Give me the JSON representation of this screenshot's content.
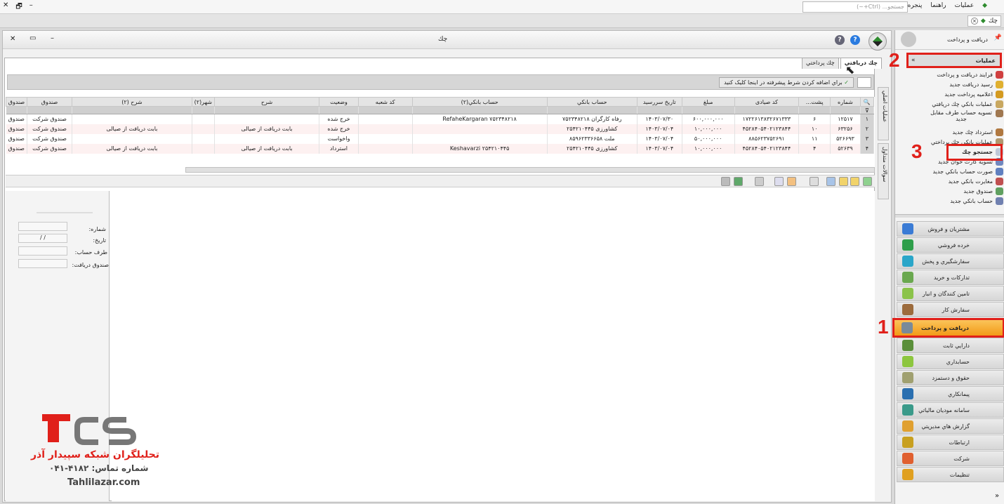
{
  "app": {
    "menu": [
      "عملیات",
      "راهنما",
      "پنجره"
    ],
    "search_placeholder": "جستجو... (Ctrl+~)",
    "doc_tab": "چك"
  },
  "window": {
    "title": "چك"
  },
  "tabs": [
    "چك دريافتي",
    "چك پرداختي"
  ],
  "filter_hint": "براي اضافه كردن شرط پيشرفته در اينجا كليک كنيد",
  "grid": {
    "columns": [
      "شماره",
      "پشت...",
      "کد صیادی",
      "مبلغ",
      "تاريخ سررسيد",
      "حساب بانكي",
      "حساب بانكي(۲)",
      "کد شعبه",
      "وضعیت",
      "شرح",
      "شهر(۲)",
      "شرح (۲)",
      "صندوق",
      "صندوق"
    ],
    "rows": [
      {
        "n": "۱",
        "cells": [
          "۱۲۵۱۷",
          "۶",
          "۱۷۲۲۶۱۳۸۳۲۶۷۱۳۳۳",
          "۶۰۰,۰۰۰,۰۰۰",
          "۱۴۰۳/۰۷/۳۰",
          "رفاه کارگران  ۷۵۲۳۴۸۲۱۸",
          "RefaheKargaran  ۷۵۲۳۴۸۲۱۸",
          "",
          "خرج شده",
          "",
          "",
          "",
          "صندوق شرکت",
          "صندوق"
        ]
      },
      {
        "n": "۲",
        "cells": [
          "۶۳۲۵۶",
          "۱۰",
          "۴۵۲۸۴۰۵۴۰۲۱۲۳۸۴۴",
          "۱۰,۰۰۰,۰۰۰",
          "۱۴۰۳/۰۷/۰۴",
          "کشاورزی  ۲۵۴۲۱۰۴۴۵",
          "",
          "",
          "خرج شده",
          "بابت دریافت از صیالی",
          "",
          "بابت دریافت از صیالی",
          "صندوق شرکت",
          "صندوق"
        ]
      },
      {
        "n": "۳",
        "cells": [
          "۵۲۶۶۹۳",
          "۱۱",
          "۸۸۵۶۲۳۷۵۲۶۹۱",
          "۵۰,۰۰۰,۰۰۰",
          "۱۴۰۳/۰۷/۰۴",
          "ملت  ۸۵۹۶۲۳۳۶۶۵۸",
          "",
          "",
          "واخواست",
          "",
          "",
          "",
          "صندوق شرکت",
          "صندوق"
        ]
      },
      {
        "n": "۴",
        "cells": [
          "۵۲۶۳۹",
          "۴",
          "۴۵۲۸۴۰۵۴۰۲۱۲۳۸۴۴",
          "۱۰,۰۰۰,۰۰۰",
          "۱۴۰۳/۰۷/۰۴",
          "کشاورزی  ۲۵۴۲۱۰۴۴۵",
          "Keshavarzi  ۲۵۴۲۱۰۴۴۵",
          "",
          "استرداد",
          "بابت دریافت از صیالی",
          "",
          "بابت دریافت از صیالی",
          "صندوق شرکت",
          "صندوق"
        ]
      }
    ]
  },
  "details": {
    "number": "شماره:",
    "date": "تاريخ:",
    "date_value": "/ /",
    "party": "طرف حساب:",
    "cashbox": "صندوق دريافت:"
  },
  "side_tabs": [
    "عمليات اصلي",
    "سوالات متداول"
  ],
  "right_panel": {
    "title": "دريافت و پرداخت",
    "ops_title": "عمليات",
    "ops": [
      "فرايند دريافت و پرداخت",
      "رسيد دريافت جديد",
      "اعلاميه پرداخت جديد",
      "عمليات بانكي چك دريافتي",
      "تسويه حساب طرف مقابل جديد",
      "استرداد چك جديد",
      "عمليات بانكي چك پرداختي",
      "جستجو چك",
      "تسويه كارت خوان جديد",
      "صورت حساب بانكي جديد",
      "مغايرت بانكي جديد",
      "صندوق جديد",
      "حساب بانكي جديد"
    ],
    "modules": [
      "مشتريان و فروش",
      "خرده فروشي",
      "سفارشگيري و پخش",
      "تداركات و خريد",
      "تامين كنندگان و انبار",
      "سفارش كار",
      "دريافت و پرداخت",
      "دارايي ثابت",
      "حسابداري",
      "حقوق و دستمزد",
      "پيمانكاري",
      "سامانه موديان مالياتي",
      "گزارش هاي مديريتي",
      "ارتباطات",
      "شركت",
      "تنظيمات"
    ],
    "module_colors": [
      "#3a7bd5",
      "#2e9e4a",
      "#2aa6c9",
      "#6aa84f",
      "#8bc34a",
      "#9c6b3c",
      "#7a8a99",
      "#5a8f3a",
      "#8dc63f",
      "#a0a070",
      "#2a6fb0",
      "#3a9a8a",
      "#e0a030",
      "#c8a020",
      "#e06030",
      "#e0a020"
    ]
  },
  "annotations": [
    "1",
    "2",
    "3"
  ],
  "watermark": {
    "line1": "تحلیلگران شبکه سپیدار آذر",
    "line2": "شماره تماس:  ۴۱۸۲-۰۴۱",
    "line3": "Tahlilazar.com"
  }
}
